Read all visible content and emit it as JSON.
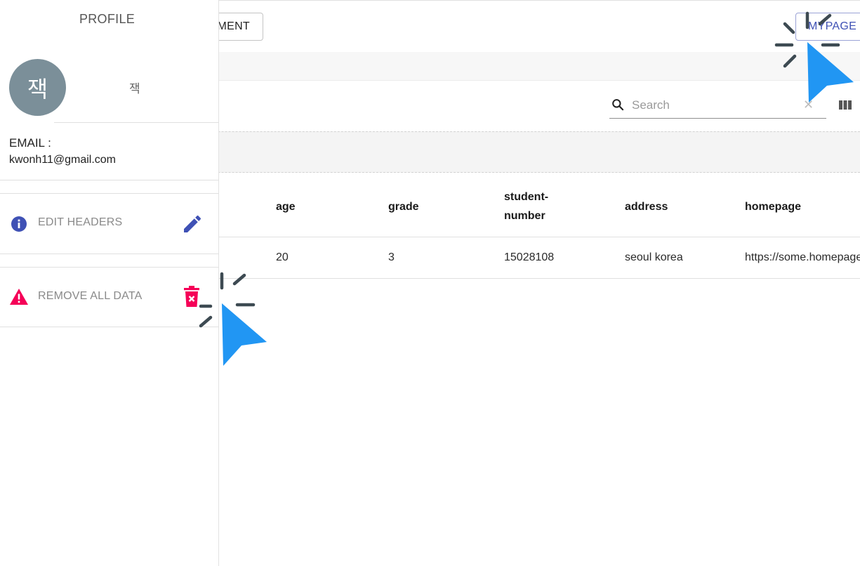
{
  "header": {
    "management_label": "MENT",
    "mypage_label": "MYPAGE"
  },
  "toolbar": {
    "search_placeholder": "Search",
    "search_icon": "search-icon",
    "clear_icon": "close-icon",
    "columns_icon": "view-column-icon"
  },
  "table": {
    "headers": [
      "age",
      "grade",
      "student-number",
      "address",
      "homepage"
    ],
    "rows": [
      [
        "20",
        "3",
        "15028108",
        "seoul korea",
        "https://some.homepage"
      ]
    ]
  },
  "drawer": {
    "title": "PROFILE",
    "avatar_text": "잭",
    "user_name": "잭",
    "email_label": "EMAIL :",
    "email_value": "kwonh11@gmail.com",
    "menu": [
      {
        "label": "EDIT HEADERS",
        "icon": "info-icon",
        "action_icon": "edit-icon",
        "color": "#3f51b5"
      },
      {
        "label": "REMOVE ALL DATA",
        "icon": "warning-icon",
        "action_icon": "trash-icon",
        "color": "#f50057"
      }
    ]
  },
  "colors": {
    "primary": "#3f51b5",
    "secondary": "#f50057",
    "avatar": "#7b8f99",
    "cursor": "#2196f3"
  }
}
